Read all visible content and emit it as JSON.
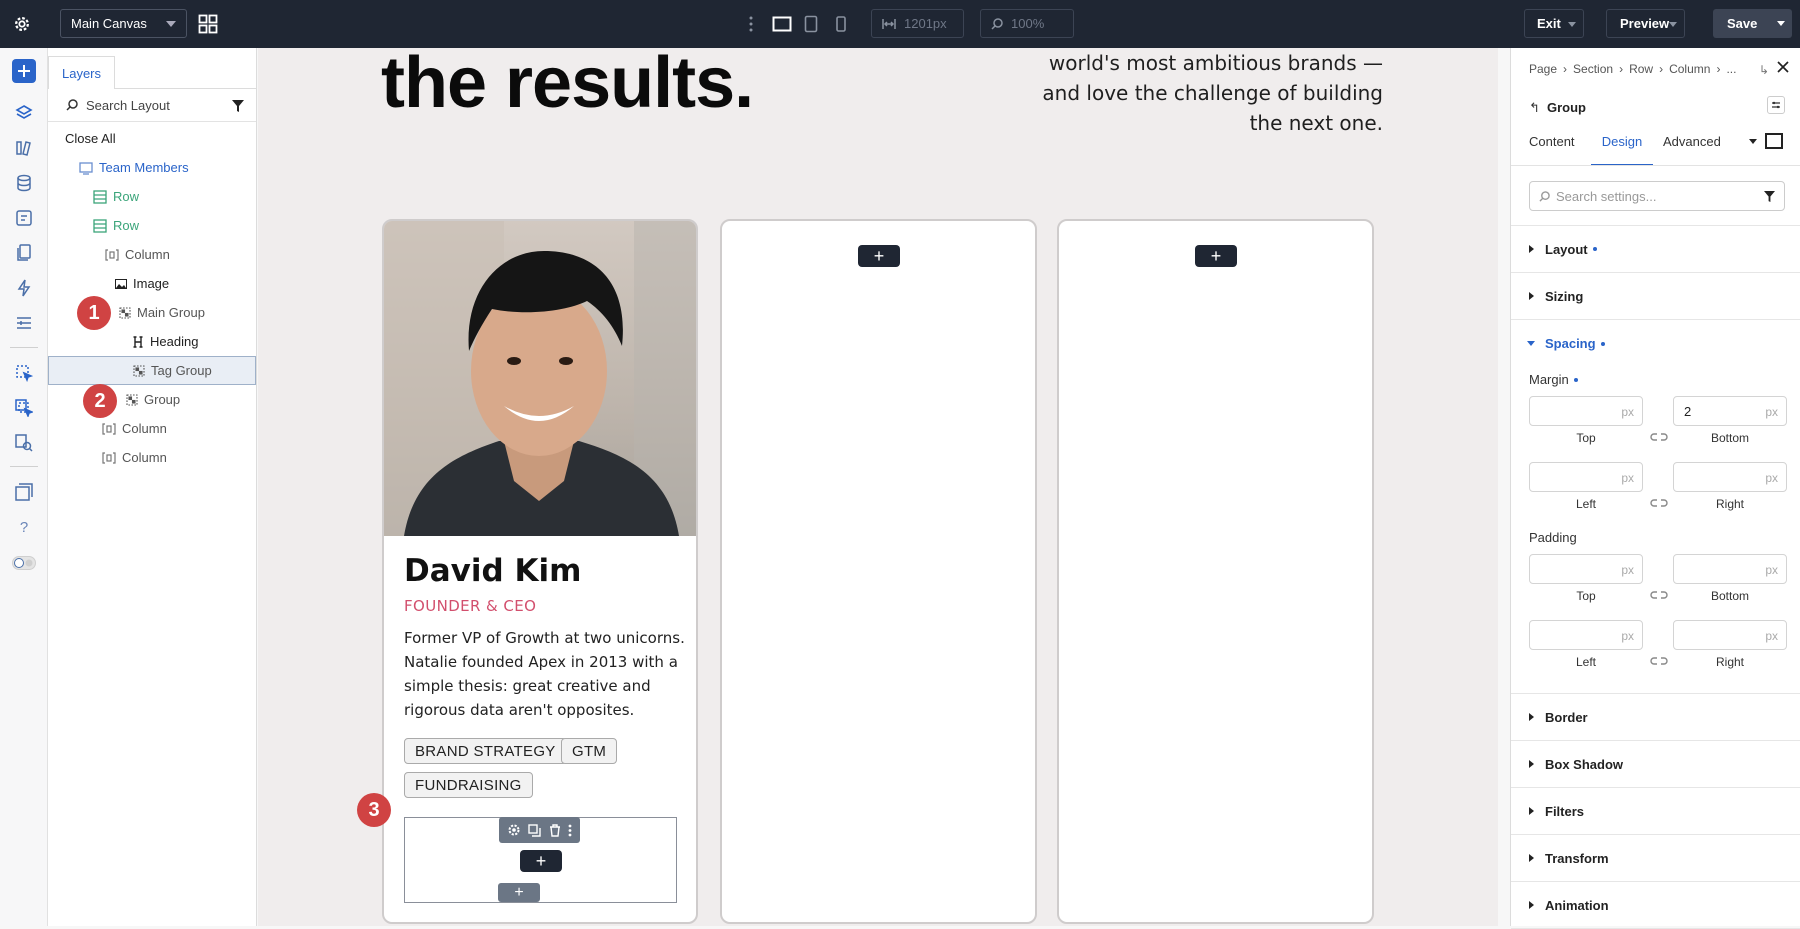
{
  "topbar": {
    "canvas_select": "Main Canvas",
    "width_readout": "1201px",
    "zoom_readout": "100%",
    "exit_label": "Exit",
    "preview_label": "Preview",
    "save_label": "Save"
  },
  "layers": {
    "tab_label": "Layers",
    "search_placeholder": "Search Layout",
    "close_all": "Close All",
    "items": [
      {
        "label": "Team Members"
      },
      {
        "label": "Row"
      },
      {
        "label": "Row"
      },
      {
        "label": "Column"
      },
      {
        "label": "Image"
      },
      {
        "label": "Main Group"
      },
      {
        "label": "Heading"
      },
      {
        "label": "Tag Group"
      },
      {
        "label": "Group"
      },
      {
        "label": "Column"
      },
      {
        "label": "Column"
      }
    ]
  },
  "canvas": {
    "headline": "the results.",
    "intro_lines": [
      "world's most ambitious brands —",
      "and love the challenge of building",
      "the next one."
    ],
    "card": {
      "name": "David Kim",
      "role": "FOUNDER & CEO",
      "bio_lines": [
        "Former VP of Growth at two unicorns.",
        "Natalie founded Apex in 2013 with a",
        "simple thesis: great creative and",
        "rigorous data aren't opposites."
      ],
      "tags": [
        "BRAND STRATEGY",
        "GTM",
        "FUNDRAISING"
      ]
    },
    "add_symbol": "+"
  },
  "badges": [
    "1",
    "2",
    "3"
  ],
  "settings": {
    "breadcrumb": [
      "Page",
      "Section",
      "Row",
      "Column",
      "..."
    ],
    "module_title": "Group",
    "tabs": [
      "Content",
      "Design",
      "Advanced"
    ],
    "active_tab": "Design",
    "search_placeholder": "Search settings...",
    "sections": {
      "layout": "Layout",
      "sizing": "Sizing",
      "spacing": "Spacing",
      "border": "Border",
      "box_shadow": "Box Shadow",
      "filters": "Filters",
      "transform": "Transform",
      "animation": "Animation"
    },
    "margin": {
      "label": "Margin",
      "top": "",
      "bottom": "2",
      "left": "",
      "right": "",
      "unit": "px",
      "labels": {
        "top": "Top",
        "bottom": "Bottom",
        "left": "Left",
        "right": "Right"
      }
    },
    "padding": {
      "label": "Padding",
      "top": "",
      "bottom": "",
      "left": "",
      "right": "",
      "unit": "px",
      "labels": {
        "top": "Top",
        "bottom": "Bottom",
        "left": "Left",
        "right": "Right"
      }
    }
  },
  "colors": {
    "accent": "#2a64c9",
    "role": "#d24f6d",
    "badge": "#d04343",
    "topbar": "#1f2633",
    "layer_green": "#3ba57a"
  },
  "icons": [
    "settings-gear-icon",
    "grid-view-icon",
    "desktop-icon",
    "tablet-icon",
    "phone-icon",
    "width-icon",
    "zoom-icon",
    "add-icon",
    "layers-icon",
    "search-icon",
    "filter-icon"
  ]
}
